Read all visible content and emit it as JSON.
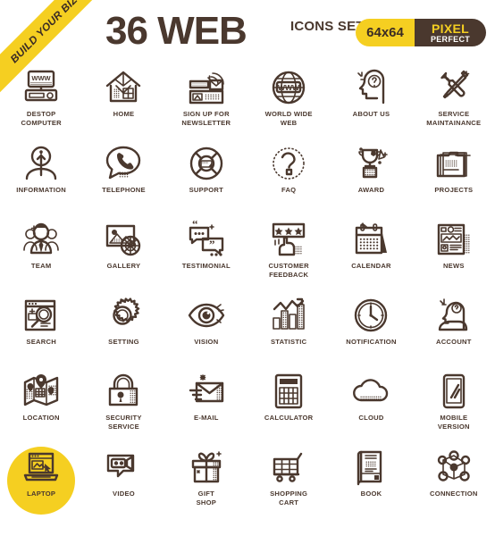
{
  "ribbon": {
    "text": "BUILD YOUR BIZ"
  },
  "header": {
    "title": "36 WEB",
    "subtitle": "ICONS\nSET",
    "badge": {
      "size": "64x64",
      "line1": "PIXEL",
      "line2": "PERFECT"
    }
  },
  "colors": {
    "accent_yellow": "#f5cf21",
    "dark_brown": "#4a382e",
    "background": "#ffffff"
  },
  "icons": [
    {
      "label": "DESTOP\nCOMPUTER",
      "name": "desktop-computer-icon",
      "highlight": false
    },
    {
      "label": "HOME",
      "name": "home-icon",
      "highlight": false
    },
    {
      "label": "SIGN UP FOR\nNEWSLETTER",
      "name": "newsletter-signup-icon",
      "highlight": false
    },
    {
      "label": "WORLD WIDE\nWEB",
      "name": "world-wide-web-icon",
      "highlight": false
    },
    {
      "label": "ABOUT US",
      "name": "about-us-icon",
      "highlight": false
    },
    {
      "label": "SERVICE\nMAINTAINANCE",
      "name": "service-maintenance-icon",
      "highlight": false
    },
    {
      "label": "INFORMATION",
      "name": "information-icon",
      "highlight": false
    },
    {
      "label": "TELEPHONE",
      "name": "telephone-icon",
      "highlight": false
    },
    {
      "label": "SUPPORT",
      "name": "support-icon",
      "highlight": false
    },
    {
      "label": "FAQ",
      "name": "faq-icon",
      "highlight": false
    },
    {
      "label": "AWARD",
      "name": "award-icon",
      "highlight": false
    },
    {
      "label": "PROJECTS",
      "name": "projects-icon",
      "highlight": false
    },
    {
      "label": "TEAM",
      "name": "team-icon",
      "highlight": false
    },
    {
      "label": "GALLERY",
      "name": "gallery-icon",
      "highlight": false
    },
    {
      "label": "TESTIMONIAL",
      "name": "testimonial-icon",
      "highlight": false
    },
    {
      "label": "CUSTOMER\nFEEDBACK",
      "name": "customer-feedback-icon",
      "highlight": false
    },
    {
      "label": "CALENDAR",
      "name": "calendar-icon",
      "highlight": false
    },
    {
      "label": "NEWS",
      "name": "news-icon",
      "highlight": false
    },
    {
      "label": "SEARCH",
      "name": "search-icon",
      "highlight": false
    },
    {
      "label": "SETTING",
      "name": "setting-icon",
      "highlight": false
    },
    {
      "label": "VISION",
      "name": "vision-icon",
      "highlight": false
    },
    {
      "label": "STATISTIC",
      "name": "statistic-icon",
      "highlight": false
    },
    {
      "label": "NOTIFICATION",
      "name": "notification-icon",
      "highlight": false
    },
    {
      "label": "ACCOUNT",
      "name": "account-icon",
      "highlight": false
    },
    {
      "label": "LOCATION",
      "name": "location-icon",
      "highlight": false
    },
    {
      "label": "SECURITY\nSERVICE",
      "name": "security-service-icon",
      "highlight": false
    },
    {
      "label": "E-MAIL",
      "name": "email-icon",
      "highlight": false
    },
    {
      "label": "CALCULATOR",
      "name": "calculator-icon",
      "highlight": false
    },
    {
      "label": "CLOUD",
      "name": "cloud-icon",
      "highlight": false
    },
    {
      "label": "MOBILE\nVERSION",
      "name": "mobile-version-icon",
      "highlight": false
    },
    {
      "label": "LAPTOP",
      "name": "laptop-icon",
      "highlight": true
    },
    {
      "label": "VIDEO",
      "name": "video-icon",
      "highlight": false
    },
    {
      "label": "GIFT\nSHOP",
      "name": "gift-shop-icon",
      "highlight": false
    },
    {
      "label": "SHOPPING\nCART",
      "name": "shopping-cart-icon",
      "highlight": false
    },
    {
      "label": "BOOK",
      "name": "book-icon",
      "highlight": false
    },
    {
      "label": "CONNECTION",
      "name": "connection-icon",
      "highlight": false
    }
  ]
}
